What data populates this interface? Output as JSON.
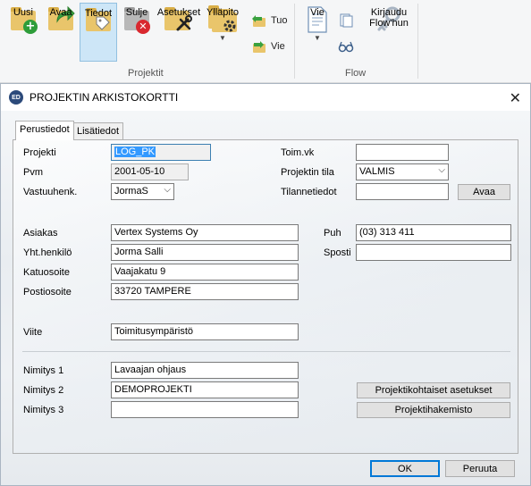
{
  "ribbon": {
    "projektit": {
      "group_label": "Projektit",
      "uusi": "Uusi",
      "avaa": "Avaa",
      "tiedot": "Tiedot",
      "sulje": "Sulje",
      "asetukset": "Asetukset",
      "yllapito": "Ylläpito",
      "tuo": "Tuo",
      "vie": "Vie"
    },
    "flow": {
      "group_label": "Flow",
      "vie": "Vie",
      "kirjaudu": "Kirjaudu Flow'hun"
    }
  },
  "dialog": {
    "logo_text": "ED",
    "title": "PROJEKTIN ARKISTOKORTTI",
    "tabs": [
      "Perustiedot",
      "Lisätiedot"
    ],
    "labels": {
      "projekti": "Projekti",
      "pvm": "Pvm",
      "vastuuhenk": "Vastuuhenk.",
      "toim_vk": "Toim.vk",
      "projektin_tila": "Projektin tila",
      "tilannetiedot": "Tilannetiedot",
      "asiakas": "Asiakas",
      "yht_henkilo": "Yht.henkilö",
      "katuosoite": "Katuosoite",
      "postiosoite": "Postiosoite",
      "puh": "Puh",
      "sposti": "Sposti",
      "viite": "Viite",
      "nimitys1": "Nimitys 1",
      "nimitys2": "Nimitys 2",
      "nimitys3": "Nimitys 3"
    },
    "values": {
      "projekti": "LOG_PK",
      "pvm": "2001-05-10",
      "vastuuhenk": "JormaS",
      "toim_vk": "",
      "projektin_tila": "VALMIS",
      "tilannetiedot": "",
      "asiakas": "Vertex Systems Oy",
      "yht_henkilo": "Jorma Salli",
      "katuosoite": "Vaajakatu 9",
      "postiosoite": "33720 TAMPERE",
      "puh": "(03) 313 411",
      "sposti": "",
      "viite": "Toimitusympäristö",
      "nimitys1": "Lavaajan ohjaus",
      "nimitys2": "DEMOPROJEKTI",
      "nimitys3": ""
    },
    "buttons": {
      "avaa": "Avaa",
      "projektikohtaiset_asetukset": "Projektikohtaiset asetukset",
      "projektihakemisto": "Projektihakemisto",
      "ok": "OK",
      "peruuta": "Peruuta"
    }
  },
  "colors": {
    "selection": "#3399ff",
    "ribbon_selected": "#cde6f7",
    "default_button_border": "#0078d7"
  }
}
